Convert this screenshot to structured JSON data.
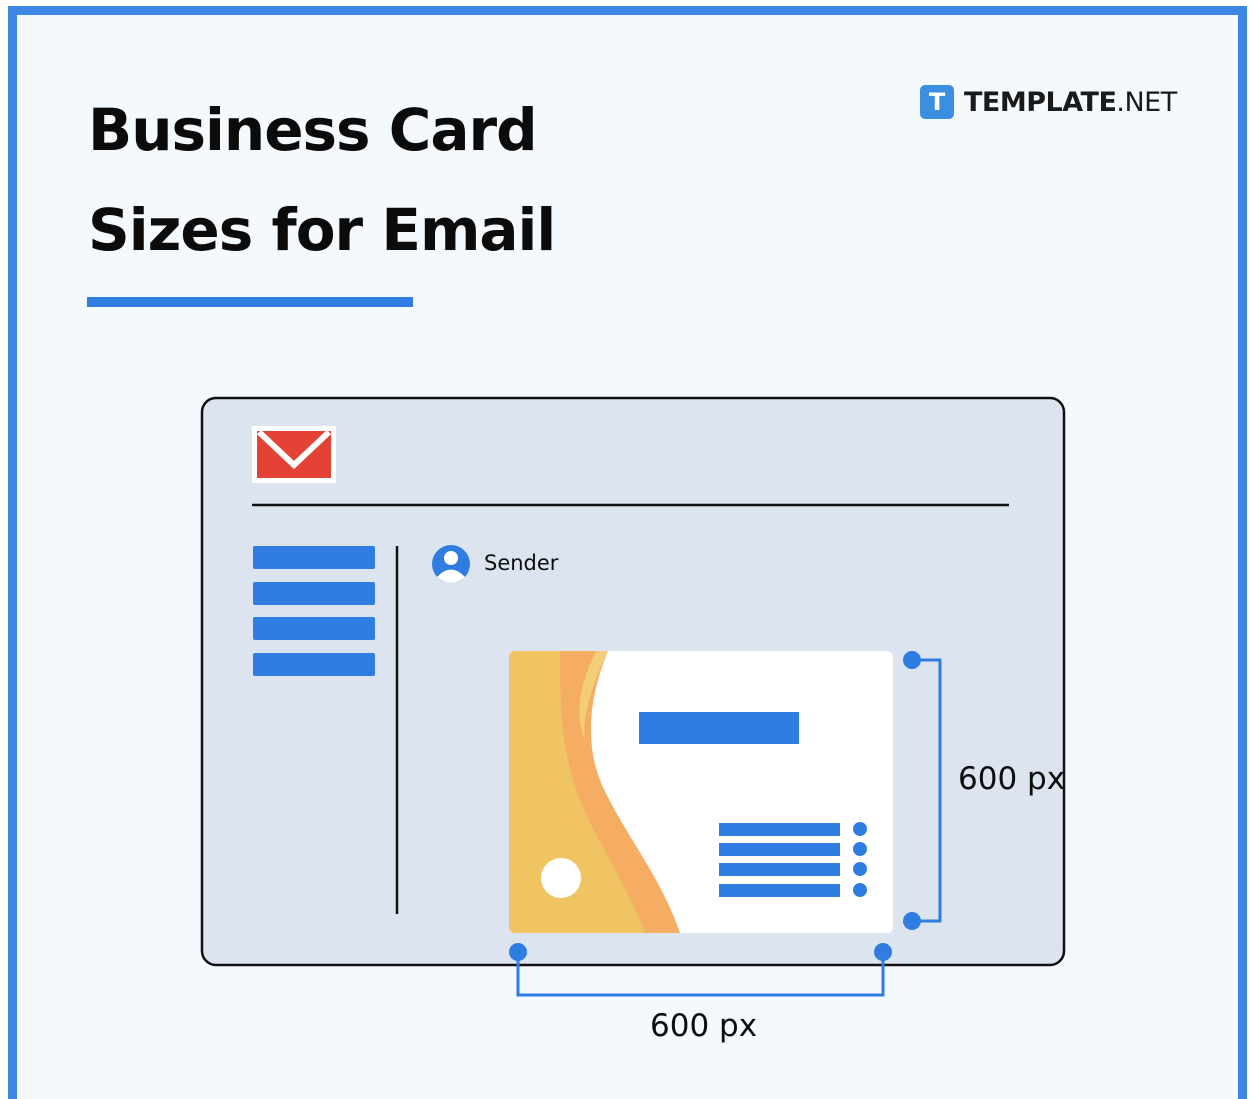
{
  "header": {
    "title_line1": "Business Card",
    "title_line2": "Sizes for Email"
  },
  "brand": {
    "logo_letter": "T",
    "name_bold": "TEMPLATE",
    "name_suffix": ".NET"
  },
  "email_window": {
    "sender_label": "Sender"
  },
  "dimensions": {
    "height_label": "600 px",
    "width_label": "600 px"
  },
  "colors": {
    "frame_border": "#3d86e3",
    "accent_blue": "#2f7de1",
    "mail_icon_red": "#e34234",
    "card_yellow": "#f0c463",
    "card_orange": "#f4ad62",
    "window_bg": "#dce5ef"
  }
}
